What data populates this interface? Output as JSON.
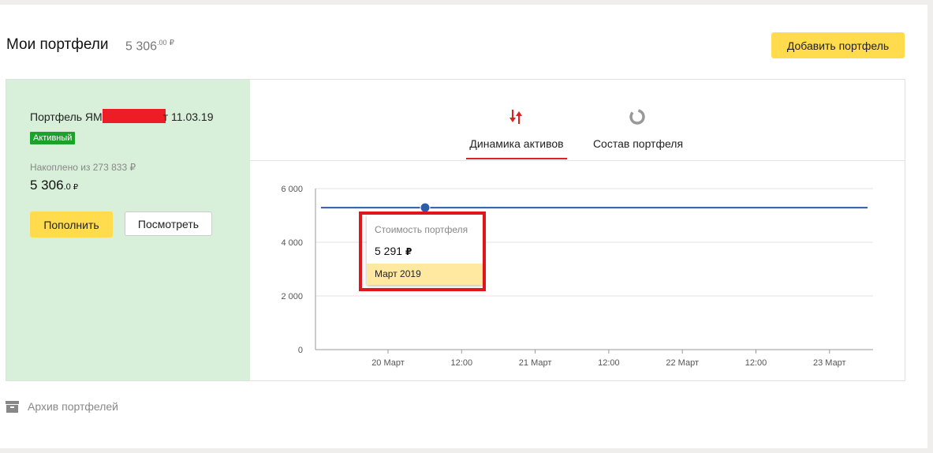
{
  "header": {
    "title": "Мои портфели",
    "total_int": "5 306",
    "total_dec": ".00",
    "currency": "₽",
    "add_button": "Добавить портфель"
  },
  "portfolio": {
    "name_prefix": "Портфель ЯМ",
    "name_suffix": "т 11.03.19",
    "status": "Активный",
    "accumulated_label": "Накоплено из 273 833 ₽",
    "value_int": "5 306",
    "value_dec": ".0",
    "currency": "₽",
    "topup_button": "Пополнить",
    "view_button": "Посмотреть"
  },
  "tabs": [
    {
      "label": "Динамика активов",
      "icon": "sort-arrows-icon",
      "active": true
    },
    {
      "label": "Состав портфеля",
      "icon": "donut-chart-icon",
      "active": false
    }
  ],
  "chart_data": {
    "type": "line",
    "y_ticks": [
      "6 000",
      "4 000",
      "2 000",
      "0"
    ],
    "x_ticks": [
      "20 Март",
      "12:00",
      "21 Март",
      "12:00",
      "22 Март",
      "12:00",
      "23 Март"
    ],
    "ylim": [
      0,
      6000
    ],
    "series": [
      {
        "values": [
          5291,
          5291,
          5291,
          5291,
          5291,
          5291,
          5291,
          5291,
          5291
        ]
      }
    ],
    "highlight_index": 1,
    "color": "#2a5ea8"
  },
  "tooltip": {
    "title": "Стоимость портфеля",
    "value": "5 291",
    "currency": "₽",
    "date": "Март 2019"
  },
  "archive": {
    "label": "Архив портфелей",
    "icon": "archive-box-icon"
  },
  "colors": {
    "accent_yellow": "#ffdb4d",
    "status_green": "#1aa32a",
    "panel_green": "#d8efd9",
    "tab_red": "#e02020"
  }
}
